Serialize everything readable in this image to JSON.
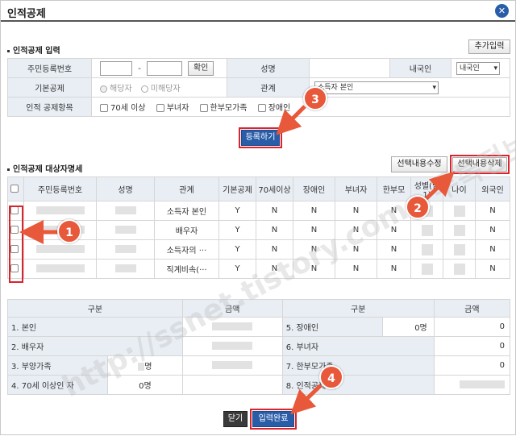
{
  "window": {
    "title": "인적공제"
  },
  "input_section": {
    "title": "인적공제 입력",
    "add_button": "추가입력",
    "rrn_label": "주민등록번호",
    "rrn_sep": "-",
    "confirm_button": "확인",
    "name_label": "성명",
    "domestic_label": "내국인",
    "domestic_value": "내국인",
    "basic_label": "기본공제",
    "radio_yes": "해당자",
    "radio_no": "미해당자",
    "relation_label": "관계",
    "relation_value": "소득자 본인",
    "items_label": "인적 공제항목",
    "item_70": "70세 이상",
    "item_woman": "부녀자",
    "item_single": "한부모가족",
    "item_disabled": "장애인",
    "register_button": "등록하기"
  },
  "list_section": {
    "title": "인적공제 대상자명세",
    "edit_button": "선택내용수정",
    "delete_button": "선택내용삭제",
    "headers": [
      "주민등록번호",
      "성명",
      "관계",
      "기본공제",
      "70세이상",
      "장애인",
      "부녀자",
      "한부모",
      "성별(남1)",
      "나이",
      "외국인"
    ],
    "rows": [
      {
        "relation": "소득자 본인",
        "basic": "Y",
        "over70": "N",
        "disabled": "N",
        "woman": "N",
        "single": "N",
        "foreign": "N"
      },
      {
        "relation": "배우자",
        "basic": "Y",
        "over70": "N",
        "disabled": "N",
        "woman": "N",
        "single": "N",
        "foreign": "N"
      },
      {
        "relation": "소득자의 ···",
        "basic": "Y",
        "over70": "N",
        "disabled": "N",
        "woman": "N",
        "single": "N",
        "foreign": "N"
      },
      {
        "relation": "직계비속(···",
        "basic": "Y",
        "over70": "N",
        "disabled": "N",
        "woman": "N",
        "single": "N",
        "foreign": "N"
      }
    ]
  },
  "summary": {
    "col_category": "구분",
    "col_amount": "금액",
    "r1": "1. 본인",
    "r2": "2. 배우자",
    "r3": "3. 부양가족",
    "r3_count": "명",
    "r4": "4. 70세 이상인 자",
    "r4_count": "0명",
    "r5": "5. 장애인",
    "r5_count": "0명",
    "r5_amount": "0",
    "r6": "6. 부녀자",
    "r6_amount": "0",
    "r7": "7. 한부모가족",
    "r7_amount": "0",
    "r8": "8. 인적공제 계",
    "close_button": "닫기",
    "complete_button": "입력완료"
  },
  "callouts": [
    "1",
    "2",
    "3",
    "4"
  ],
  "watermark": "http://ssnet.tistory.com - 투톡정보",
  "colors": {
    "primary_blue": "#2a5da8",
    "callout": "#e8583a",
    "highlight": "#d8242c",
    "label_bg": "#e9eef5"
  }
}
